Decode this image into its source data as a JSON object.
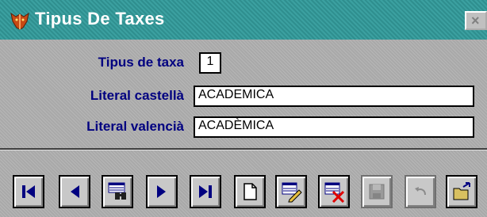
{
  "window": {
    "title": "Tipus De Taxes",
    "close_label": "×"
  },
  "form": {
    "tipus_label": "Tipus de taxa",
    "tipus_value": "1",
    "castella_label": "Literal castellà",
    "castella_value": "ACADEMICA",
    "valencia_label": "Literal valencià",
    "valencia_value": "ACADÈMICA"
  },
  "toolbar": {
    "buttons": [
      {
        "icon": "first-record-icon",
        "enabled": true
      },
      {
        "icon": "previous-record-icon",
        "enabled": true
      },
      {
        "icon": "search-binoculars-icon",
        "enabled": true
      },
      {
        "icon": "next-record-icon",
        "enabled": true
      },
      {
        "icon": "last-record-icon",
        "enabled": true
      },
      {
        "icon": "new-document-icon",
        "enabled": true
      },
      {
        "icon": "edit-record-icon",
        "enabled": true
      },
      {
        "icon": "delete-record-icon",
        "enabled": true
      },
      {
        "icon": "save-disk-icon",
        "enabled": false
      },
      {
        "icon": "undo-icon",
        "enabled": false
      },
      {
        "icon": "exit-folder-icon",
        "enabled": true
      }
    ]
  },
  "colors": {
    "title_bar": "#3ba0a0",
    "label_text": "#000080",
    "nav_arrow": "#000080",
    "delete_x": "#e00000"
  }
}
